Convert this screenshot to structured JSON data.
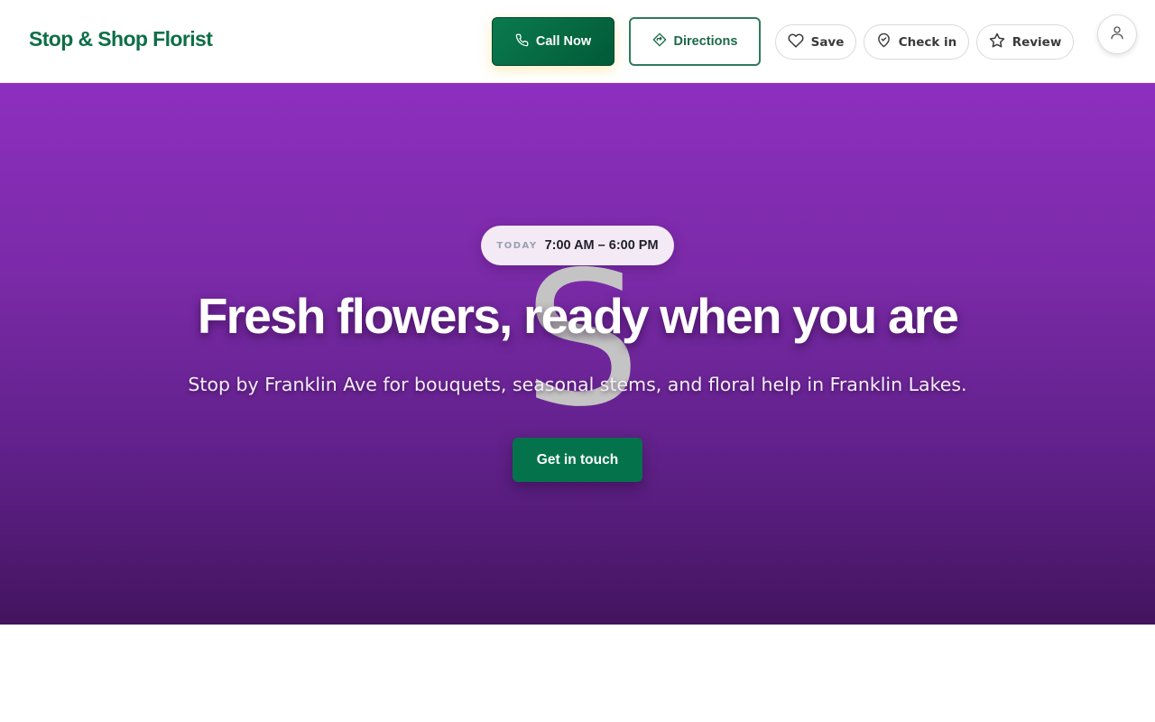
{
  "header": {
    "brand": "Stop & Shop Florist",
    "call_label": "Call Now",
    "directions_label": "Directions",
    "save_label": "Save",
    "checkin_label": "Check in",
    "review_label": "Review"
  },
  "hero": {
    "hours_label": "TODAY",
    "hours_value": "7:00 AM – 6:00 PM",
    "watermark": "S",
    "headline": "Fresh flowers, ready when you are",
    "subtitle": "Stop by Franklin Ave for bouquets, seasonal stems, and floral help in Franklin Lakes.",
    "cta_label": "Get in touch"
  },
  "icons": {
    "call": "phone-icon",
    "directions": "directions-icon",
    "save": "heart-icon",
    "checkin": "map-pin-icon",
    "review": "star-icon",
    "account": "user-icon"
  },
  "colors": {
    "brand_green": "#0e6e48",
    "hero_top": "#8d2fbf",
    "hero_bottom": "#43145f",
    "cta_green": "#04734c"
  }
}
